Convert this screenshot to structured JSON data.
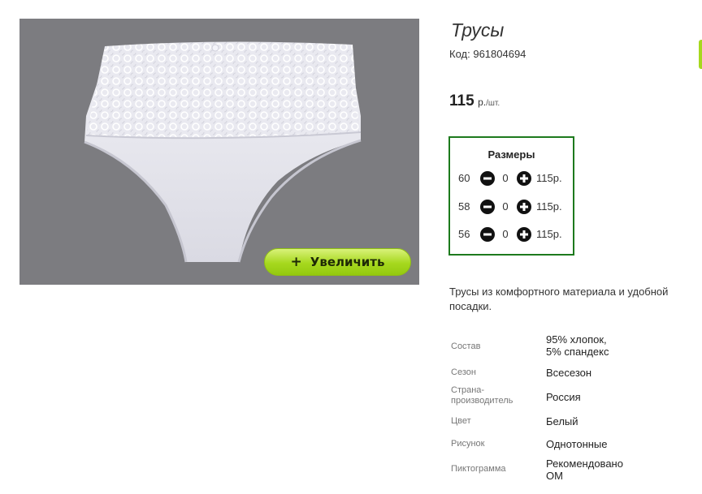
{
  "product": {
    "title": "Трусы",
    "code_label": "Код:",
    "code_value": "961804694",
    "price_amount": "115",
    "price_unit": "р.",
    "price_per": "/шт."
  },
  "image": {
    "background_color": "#7c7c80",
    "zoom_label": "Увеличить",
    "zoom_icon": "plus-icon"
  },
  "sizes": {
    "title": "Размеры",
    "rows": [
      {
        "size": "60",
        "qty": "0",
        "price": "115р."
      },
      {
        "size": "58",
        "qty": "0",
        "price": "115р."
      },
      {
        "size": "56",
        "qty": "0",
        "price": "115р."
      }
    ],
    "border_color": "#1d7a1d"
  },
  "description": "Трусы из комфортного материала и удобной посадки.",
  "specs": [
    {
      "label": "Состав",
      "value": "95% хлопок,\n5% спандекс"
    },
    {
      "label": "Сезон",
      "value": "Всесезон"
    },
    {
      "label": "Страна-\nпроизводитель",
      "value": "Россия"
    },
    {
      "label": "Цвет",
      "value": "Белый"
    },
    {
      "label": "Рисунок",
      "value": "Однотонные"
    },
    {
      "label": "Пиктограмма",
      "value": "Рекомендовано\nОМ"
    }
  ],
  "colors": {
    "accent_green": "#a6d81e"
  }
}
